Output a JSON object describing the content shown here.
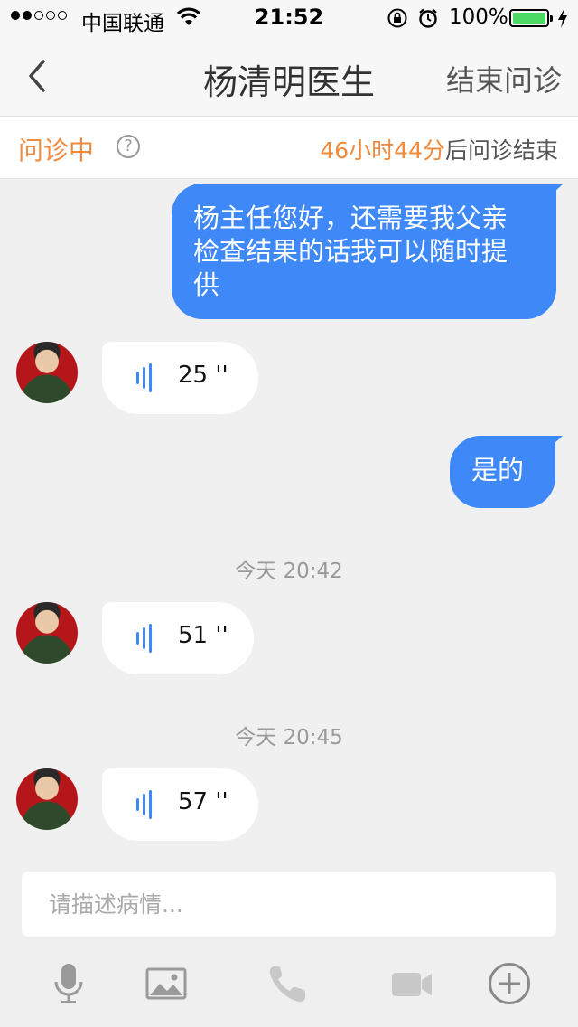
{
  "status_bar": {
    "carrier": "中国联通",
    "time": "21:52",
    "battery_percent": "100%",
    "battery_level": 1.0,
    "signal_strength": 2,
    "signal_max": 5
  },
  "navbar": {
    "title": "杨清明医生",
    "end_button": "结束问诊",
    "back_icon": "chevron-left-icon"
  },
  "consultation": {
    "status": "问诊中",
    "help_icon": "question-circle-icon",
    "countdown_value": "46小时44分",
    "countdown_suffix": "后问诊结束"
  },
  "messages": [
    {
      "type": "text",
      "direction": "out",
      "text": "杨主任您好，还需要我父亲检查结果的话我可以随时提供"
    },
    {
      "type": "voice",
      "direction": "in",
      "duration": "25 ''"
    },
    {
      "type": "text",
      "direction": "out",
      "text": "是的"
    },
    {
      "type": "timestamp",
      "text": "今天 20:42"
    },
    {
      "type": "voice",
      "direction": "in",
      "duration": "51 ''"
    },
    {
      "type": "timestamp",
      "text": "今天 20:45"
    },
    {
      "type": "voice",
      "direction": "in",
      "duration": "57 ''"
    }
  ],
  "message_lines": {
    "msg1_line1": "杨主任您好，还需要我父亲",
    "msg1_line2": "检查结果的话我可以随时提",
    "msg1_line3": "供"
  },
  "input": {
    "placeholder": "请描述病情...",
    "value": ""
  },
  "toolbar": {
    "icons": [
      "microphone-icon",
      "image-icon",
      "phone-icon",
      "video-camera-icon",
      "plus-circle-icon"
    ]
  },
  "colors": {
    "accent_orange": "#f08a3d",
    "bubble_blue": "#3f88f7",
    "battery_green": "#4cd964",
    "disabled_gray": "#c8c8c8"
  }
}
